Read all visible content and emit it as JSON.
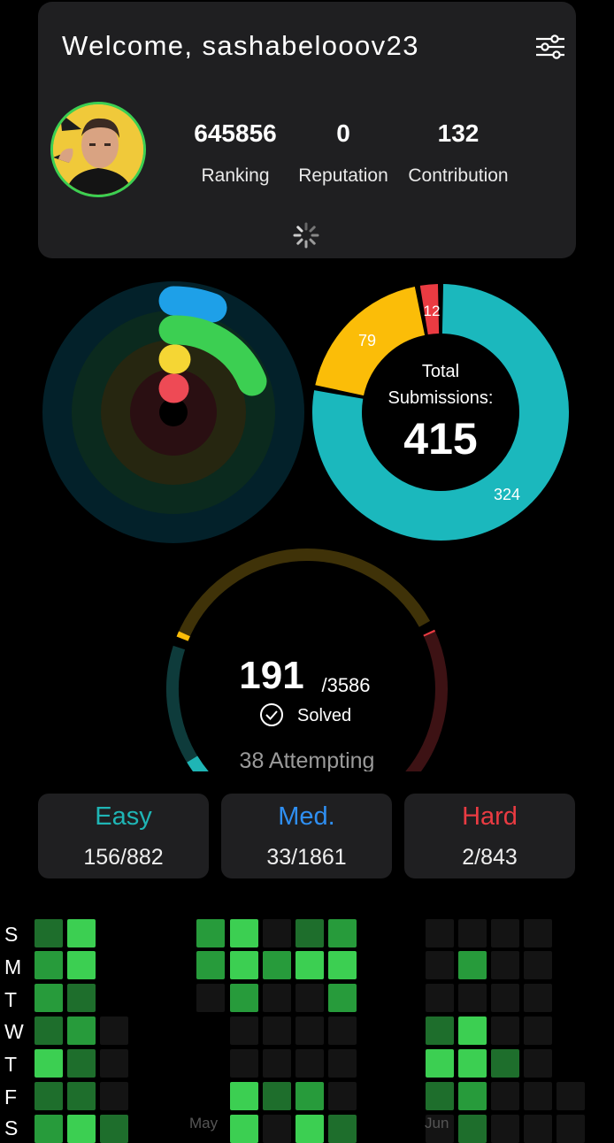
{
  "header": {
    "welcome": "Welcome,  sashabelooov23",
    "stats": [
      {
        "value": "645856",
        "label": "Ranking"
      },
      {
        "value": "0",
        "label": "Reputation"
      },
      {
        "value": "132",
        "label": "Contribution"
      }
    ]
  },
  "submissions": {
    "title_line1": "Total",
    "title_line2": "Submissions:",
    "total": "415",
    "segments": [
      {
        "label": "324",
        "value": 324,
        "color": "#1bb8bd"
      },
      {
        "label": "79",
        "value": 79,
        "color": "#fbbd08"
      },
      {
        "label": "12",
        "value": 12,
        "color": "#ea3b42"
      }
    ]
  },
  "solved": {
    "count": "191",
    "total": "/3586",
    "label": "Solved",
    "attempting": "38 Attempting",
    "easy_fraction": 0.177,
    "medium_fraction": 0.018,
    "hard_fraction": 0.002
  },
  "difficulty": [
    {
      "name": "Easy",
      "value": "156/882",
      "color": "#1fb5b5"
    },
    {
      "name": "Med.",
      "value": "33/1861",
      "color": "#2f8ff2"
    },
    {
      "name": "Hard",
      "value": "2/843",
      "color": "#ea3b42"
    }
  ],
  "calendar": {
    "days": [
      "S",
      "M",
      "T",
      "W",
      "T",
      "F",
      "S"
    ],
    "months": [
      "May",
      "Jun"
    ]
  },
  "colors": {
    "accent_green": "#3ccf52",
    "card_bg": "#1f1f21",
    "easy": "#1fb5b5",
    "medium": "#fbbd08",
    "hard": "#ea3b42"
  }
}
